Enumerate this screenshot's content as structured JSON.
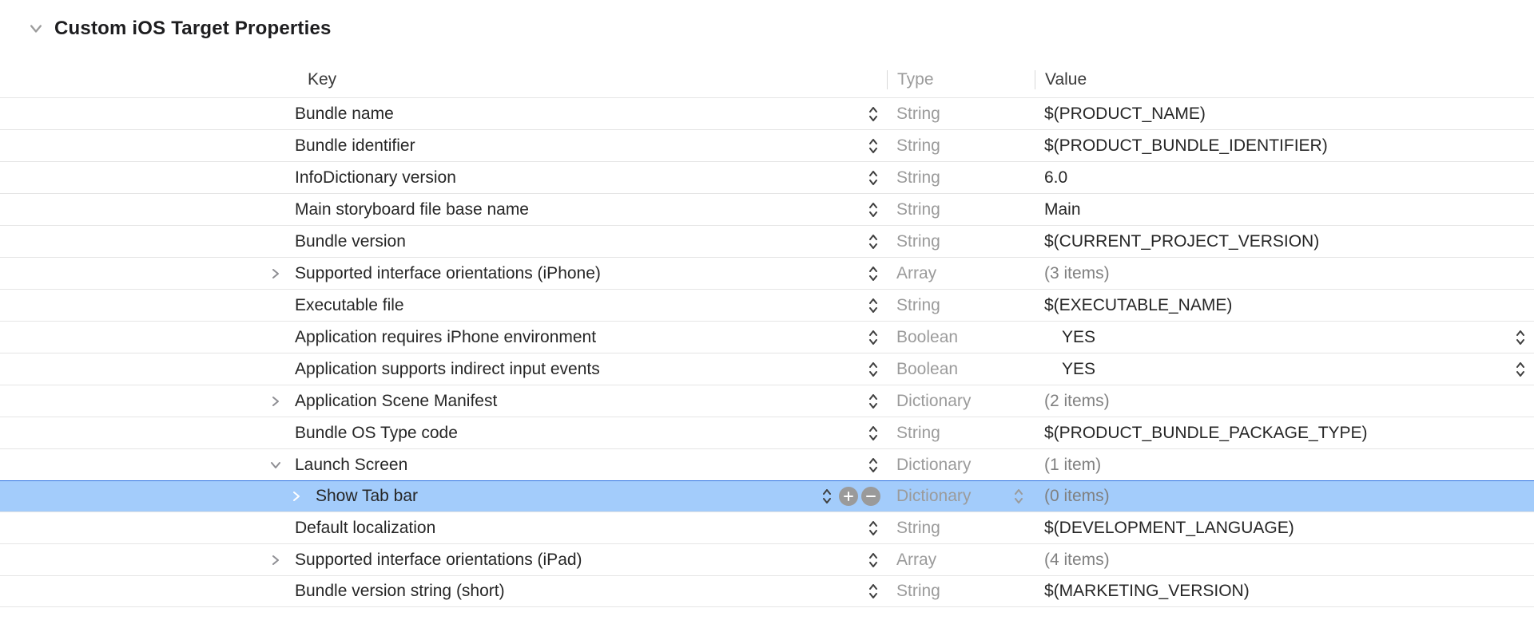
{
  "section": {
    "title": "Custom iOS Target Properties"
  },
  "columns": {
    "key": "Key",
    "type": "Type",
    "value": "Value"
  },
  "rows": [
    {
      "indent": 0,
      "disclosure": "none",
      "key": "Bundle name",
      "type": "String",
      "value": "$(PRODUCT_NAME)",
      "value_muted": false,
      "value_indent": false,
      "value_stepper": false,
      "selected": false
    },
    {
      "indent": 0,
      "disclosure": "none",
      "key": "Bundle identifier",
      "type": "String",
      "value": "$(PRODUCT_BUNDLE_IDENTIFIER)",
      "value_muted": false,
      "value_indent": false,
      "value_stepper": false,
      "selected": false
    },
    {
      "indent": 0,
      "disclosure": "none",
      "key": "InfoDictionary version",
      "type": "String",
      "value": "6.0",
      "value_muted": false,
      "value_indent": false,
      "value_stepper": false,
      "selected": false
    },
    {
      "indent": 0,
      "disclosure": "none",
      "key": "Main storyboard file base name",
      "type": "String",
      "value": "Main",
      "value_muted": false,
      "value_indent": false,
      "value_stepper": false,
      "selected": false
    },
    {
      "indent": 0,
      "disclosure": "none",
      "key": "Bundle version",
      "type": "String",
      "value": "$(CURRENT_PROJECT_VERSION)",
      "value_muted": false,
      "value_indent": false,
      "value_stepper": false,
      "selected": false
    },
    {
      "indent": 0,
      "disclosure": "right",
      "key": "Supported interface orientations (iPhone)",
      "type": "Array",
      "value": "(3 items)",
      "value_muted": true,
      "value_indent": false,
      "value_stepper": false,
      "selected": false
    },
    {
      "indent": 0,
      "disclosure": "none",
      "key": "Executable file",
      "type": "String",
      "value": "$(EXECUTABLE_NAME)",
      "value_muted": false,
      "value_indent": false,
      "value_stepper": false,
      "selected": false
    },
    {
      "indent": 0,
      "disclosure": "none",
      "key": "Application requires iPhone environment",
      "type": "Boolean",
      "value": "YES",
      "value_muted": false,
      "value_indent": true,
      "value_stepper": true,
      "selected": false
    },
    {
      "indent": 0,
      "disclosure": "none",
      "key": "Application supports indirect input events",
      "type": "Boolean",
      "value": "YES",
      "value_muted": false,
      "value_indent": true,
      "value_stepper": true,
      "selected": false
    },
    {
      "indent": 0,
      "disclosure": "right",
      "key": "Application Scene Manifest",
      "type": "Dictionary",
      "value": "(2 items)",
      "value_muted": true,
      "value_indent": false,
      "value_stepper": false,
      "selected": false
    },
    {
      "indent": 0,
      "disclosure": "none",
      "key": "Bundle OS Type code",
      "type": "String",
      "value": "$(PRODUCT_BUNDLE_PACKAGE_TYPE)",
      "value_muted": false,
      "value_indent": false,
      "value_stepper": false,
      "selected": false
    },
    {
      "indent": 0,
      "disclosure": "down",
      "key": "Launch Screen",
      "type": "Dictionary",
      "value": "(1 item)",
      "value_muted": true,
      "value_indent": false,
      "value_stepper": false,
      "selected": false
    },
    {
      "indent": 1,
      "disclosure": "right",
      "key": "Show Tab bar",
      "type": "Dictionary",
      "value": "(0 items)",
      "value_muted": true,
      "value_indent": false,
      "value_stepper": false,
      "selected": true
    },
    {
      "indent": 0,
      "disclosure": "none",
      "key": "Default localization",
      "type": "String",
      "value": "$(DEVELOPMENT_LANGUAGE)",
      "value_muted": false,
      "value_indent": false,
      "value_stepper": false,
      "selected": false
    },
    {
      "indent": 0,
      "disclosure": "right",
      "key": "Supported interface orientations (iPad)",
      "type": "Array",
      "value": "(4 items)",
      "value_muted": true,
      "value_indent": false,
      "value_stepper": false,
      "selected": false
    },
    {
      "indent": 0,
      "disclosure": "none",
      "key": "Bundle version string (short)",
      "type": "String",
      "value": "$(MARKETING_VERSION)",
      "value_muted": false,
      "value_indent": false,
      "value_stepper": false,
      "selected": false
    }
  ]
}
